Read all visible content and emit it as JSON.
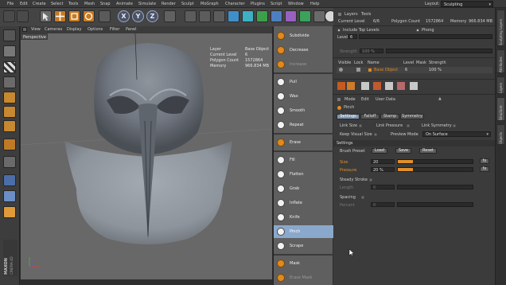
{
  "menubar": {
    "items": [
      "File",
      "Edit",
      "Create",
      "Select",
      "Tools",
      "Mesh",
      "Snap",
      "Animate",
      "Simulate",
      "Render",
      "Sculpt",
      "MoGraph",
      "Character",
      "Plugins",
      "Script",
      "Window",
      "Help"
    ],
    "layout_label": "Layout:",
    "layout_value": "Sculpting"
  },
  "toolbar": {
    "axis_buttons": [
      "X",
      "Y",
      "Z"
    ]
  },
  "viewport": {
    "menu": [
      "View",
      "Cameras",
      "Display",
      "Options",
      "Filter",
      "Panel"
    ],
    "label": "Perspective",
    "hud": [
      {
        "key": "Layer",
        "value": "Base Object"
      },
      {
        "key": "Current Level",
        "value": "6"
      },
      {
        "key": "Polygon Count",
        "value": "1572864"
      },
      {
        "key": "Memory",
        "value": "966.834 MB"
      }
    ],
    "watermark_top": "MAXON",
    "watermark_bottom": "CINEMA 4D"
  },
  "tools": {
    "items": [
      {
        "label": "Subdivide",
        "icon": "subdivide-icon"
      },
      {
        "label": "Decrease",
        "icon": "decrease-icon"
      },
      {
        "label": "Increase",
        "icon": "increase-icon"
      },
      {
        "label": "Pull",
        "icon": "pull-icon"
      },
      {
        "label": "Wax",
        "icon": "wax-icon"
      },
      {
        "label": "Smooth",
        "icon": "smooth-icon"
      },
      {
        "label": "Repeat",
        "icon": "repeat-icon"
      },
      {
        "label": "Erase",
        "icon": "erase-icon"
      },
      {
        "label": "Fill",
        "icon": "fill-icon"
      },
      {
        "label": "Flatten",
        "icon": "flatten-icon"
      },
      {
        "label": "Grab",
        "icon": "grab-icon"
      },
      {
        "label": "Inflate",
        "icon": "inflate-icon"
      },
      {
        "label": "Knife",
        "icon": "knife-icon"
      },
      {
        "label": "Pinch",
        "icon": "pinch-icon"
      },
      {
        "label": "Scrape",
        "icon": "scrape-icon"
      },
      {
        "label": "Mask",
        "icon": "mask-icon"
      },
      {
        "label": "Erase Mask",
        "icon": "erase-mask-icon"
      }
    ],
    "selected": "Pinch"
  },
  "layers": {
    "menu": [
      "Layers",
      "Tools"
    ],
    "current_level_label": "Current Level",
    "current_level": "6/6",
    "polygon_count_label": "Polygon Count",
    "polygon_count": "1572864",
    "memory_label": "Memory",
    "memory": "966.834 MB",
    "include_top_levels": "Include Top Levels",
    "phong": "Phong",
    "level_label": "Level",
    "level_value": "6",
    "strength_label": "Strength",
    "strength_value": "100 %",
    "columns": [
      "Visible",
      "Lock",
      "Name",
      "Level",
      "Mask",
      "Strength"
    ],
    "row": {
      "name": "Base Object",
      "level": "6",
      "strength": "100 %"
    }
  },
  "attributes": {
    "menu": [
      "Mode",
      "Edit",
      "User Data"
    ],
    "tool_name": "Pinch",
    "tabs": [
      "Settings",
      "Falloff",
      "Stamp",
      "Symmetry"
    ],
    "active_tab": "Settings",
    "link_size": "Link Size",
    "link_pressure": "Link Pressure",
    "link_symmetry": "Link Symmetry",
    "keep_visual_size": "Keep Visual Size",
    "preview_mode_label": "Preview Mode",
    "preview_mode_value": "On Surface",
    "section_settings": "Settings",
    "brush_preset_label": "Brush Preset",
    "load": "Load",
    "save": "Save",
    "reset": "Reset",
    "size_label": "Size",
    "size_value": "20",
    "size_fraction": 0.2,
    "pressure_label": "Pressure",
    "pressure_value": "20 %",
    "pressure_fraction": 0.2,
    "steady_stroke": "Steady Stroke",
    "length_label": "Length",
    "length_value": "0",
    "spacing": "Spacing",
    "percent_label": "Percent",
    "percent_value": "0",
    "fx": "fx"
  },
  "side_tabs": [
    "Sculpting Layers",
    "Attributes",
    "Layers",
    "Structure",
    "Objects"
  ]
}
